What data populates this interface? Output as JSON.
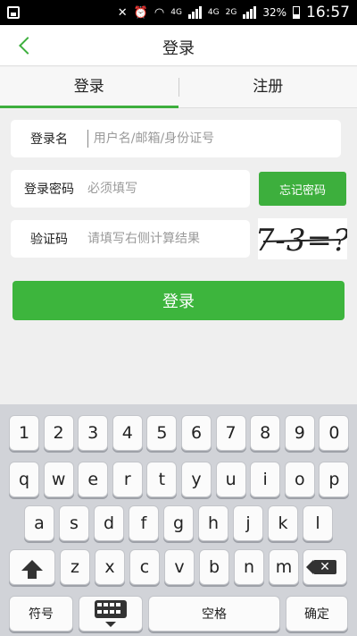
{
  "status_bar": {
    "network_labels": [
      "4G",
      "4G",
      "2G"
    ],
    "battery": "32%",
    "time": "16:57"
  },
  "header": {
    "title": "登录"
  },
  "tabs": [
    {
      "label": "登录"
    },
    {
      "label": "注册"
    }
  ],
  "form": {
    "account_label": "登录名",
    "account_placeholder": "用户名/邮箱/身份证号",
    "password_label": "登录密码",
    "password_placeholder": "必须填写",
    "forgot_label": "忘记密码",
    "captcha_label": "验证码",
    "captcha_placeholder": "请填写右侧计算结果",
    "captcha_text": "7-3=?",
    "login_button": "登录"
  },
  "keyboard": {
    "row1": [
      "1",
      "2",
      "3",
      "4",
      "5",
      "6",
      "7",
      "8",
      "9",
      "0"
    ],
    "row2": [
      "q",
      "w",
      "e",
      "r",
      "t",
      "y",
      "u",
      "i",
      "o",
      "p"
    ],
    "row3": [
      "a",
      "s",
      "d",
      "f",
      "g",
      "h",
      "j",
      "k",
      "l"
    ],
    "row4": [
      "z",
      "x",
      "c",
      "v",
      "b",
      "n",
      "m"
    ],
    "symbols": "符号",
    "space": "空格",
    "confirm": "确定"
  },
  "colors": {
    "accent": "#3daf3d",
    "background": "#efefef"
  }
}
